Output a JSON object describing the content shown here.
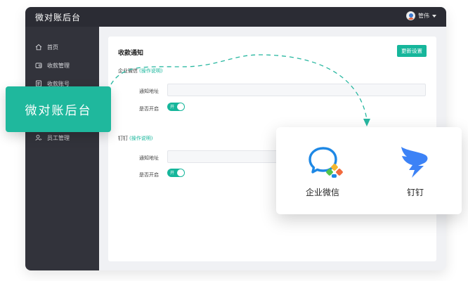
{
  "app": {
    "title": "微对账后台"
  },
  "user": {
    "name": "管伟"
  },
  "sidebar": {
    "items": [
      {
        "label": "首页",
        "icon": "home-icon"
      },
      {
        "label": "收款管理",
        "icon": "wallet-icon"
      },
      {
        "label": "收款账号",
        "icon": "account-icon"
      },
      {
        "label": "员工管理",
        "icon": "staff-icon"
      }
    ]
  },
  "main": {
    "title": "收款通知",
    "update_button": "更新设置",
    "wechat_section": {
      "label": "企业微信",
      "help": "(操作说明)"
    },
    "dingtalk_section": {
      "label": "钉钉",
      "help": "(操作说明)"
    },
    "url_label": "通知地址",
    "enable_label": "是否开启",
    "toggle_text": "开"
  },
  "badge": {
    "text": "微对账后台"
  },
  "popup": {
    "items": [
      {
        "label": "企业微信",
        "icon": "wecom-icon"
      },
      {
        "label": "钉钉",
        "icon": "dingtalk-icon"
      }
    ]
  },
  "colors": {
    "accent": "#16b69b",
    "sidebar": "#32333b",
    "titlebar": "#2b2c34",
    "dingtalk": "#3c82f6"
  }
}
